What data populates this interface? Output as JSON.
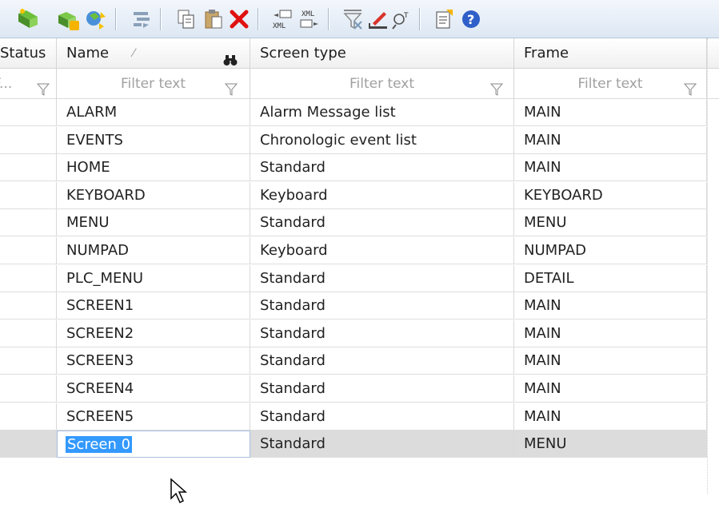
{
  "toolbar": {
    "buttons": [
      {
        "name": "new-screen-icon"
      },
      {
        "name": "add-screen-icon"
      },
      {
        "name": "refresh-icon"
      },
      {
        "name": "reference-icon"
      },
      {
        "name": "copy-icon"
      },
      {
        "name": "paste-icon"
      },
      {
        "name": "delete-icon"
      },
      {
        "name": "export-xml-icon"
      },
      {
        "name": "import-xml-icon"
      },
      {
        "name": "clear-filter-icon"
      },
      {
        "name": "rename-icon"
      },
      {
        "name": "find-icon"
      },
      {
        "name": "properties-icon"
      },
      {
        "name": "help-icon"
      }
    ]
  },
  "columns": {
    "status": "Status",
    "name": "Name",
    "screen_type": "Screen type",
    "frame": "Frame"
  },
  "filters": {
    "status": "F...",
    "name": "Filter text",
    "screen_type": "Filter text",
    "frame": "Filter text"
  },
  "rows": [
    {
      "name": "ALARM",
      "screen_type": "Alarm Message list",
      "frame": "MAIN"
    },
    {
      "name": "EVENTS",
      "screen_type": "Chronologic event list",
      "frame": "MAIN"
    },
    {
      "name": "HOME",
      "screen_type": "Standard",
      "frame": "MAIN"
    },
    {
      "name": "KEYBOARD",
      "screen_type": "Keyboard",
      "frame": "KEYBOARD"
    },
    {
      "name": "MENU",
      "screen_type": "Standard",
      "frame": "MENU"
    },
    {
      "name": "NUMPAD",
      "screen_type": "Keyboard",
      "frame": "NUMPAD"
    },
    {
      "name": "PLC_MENU",
      "screen_type": "Standard",
      "frame": "DETAIL"
    },
    {
      "name": "SCREEN1",
      "screen_type": "Standard",
      "frame": "MAIN"
    },
    {
      "name": "SCREEN2",
      "screen_type": "Standard",
      "frame": "MAIN"
    },
    {
      "name": "SCREEN3",
      "screen_type": "Standard",
      "frame": "MAIN"
    },
    {
      "name": "SCREEN4",
      "screen_type": "Standard",
      "frame": "MAIN"
    },
    {
      "name": "SCREEN5",
      "screen_type": "Standard",
      "frame": "MAIN"
    },
    {
      "name": "Screen 0",
      "screen_type": "Standard",
      "frame": "MENU",
      "editing": true
    }
  ]
}
